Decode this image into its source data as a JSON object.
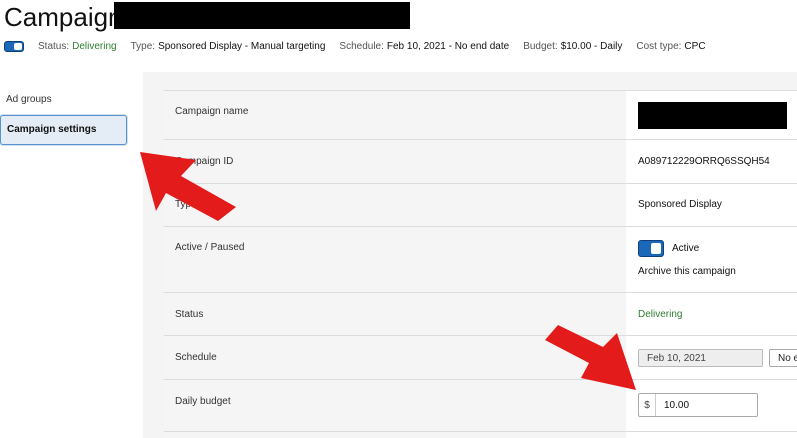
{
  "header": {
    "title": "Campaign:",
    "status_label": "Status:",
    "status_value": "Delivering",
    "type_label": "Type:",
    "type_value": "Sponsored Display - Manual targeting",
    "schedule_label": "Schedule:",
    "schedule_value": "Feb 10, 2021 - No end date",
    "budget_label": "Budget:",
    "budget_value": "$10.00 - Daily",
    "cost_label": "Cost type:",
    "cost_value": "CPC"
  },
  "sidebar": {
    "items": [
      {
        "label": "Ad groups",
        "active": false
      },
      {
        "label": "Campaign settings",
        "active": true
      }
    ]
  },
  "settings": {
    "campaign_name_label": "Campaign name",
    "campaign_id_label": "Campaign ID",
    "campaign_id_value": "A089712229ORRQ6SSQH54",
    "type_label": "Type",
    "type_value": "Sponsored Display",
    "active_label": "Active / Paused",
    "active_value": "Active",
    "archive_link": "Archive this campaign",
    "status_label": "Status",
    "status_value": "Delivering",
    "schedule_label": "Schedule",
    "start_date": "Feb 10, 2021",
    "end_date": "No e",
    "budget_label": "Daily budget",
    "currency": "$",
    "budget_value": "10.00"
  },
  "colors": {
    "accent": "#1b67b8",
    "status_green": "#2e7d32",
    "link": "#1d5fa5",
    "arrow": "#e31b1b"
  },
  "icons": [
    "toggle-switch-icon",
    "red-arrow-annotation"
  ]
}
